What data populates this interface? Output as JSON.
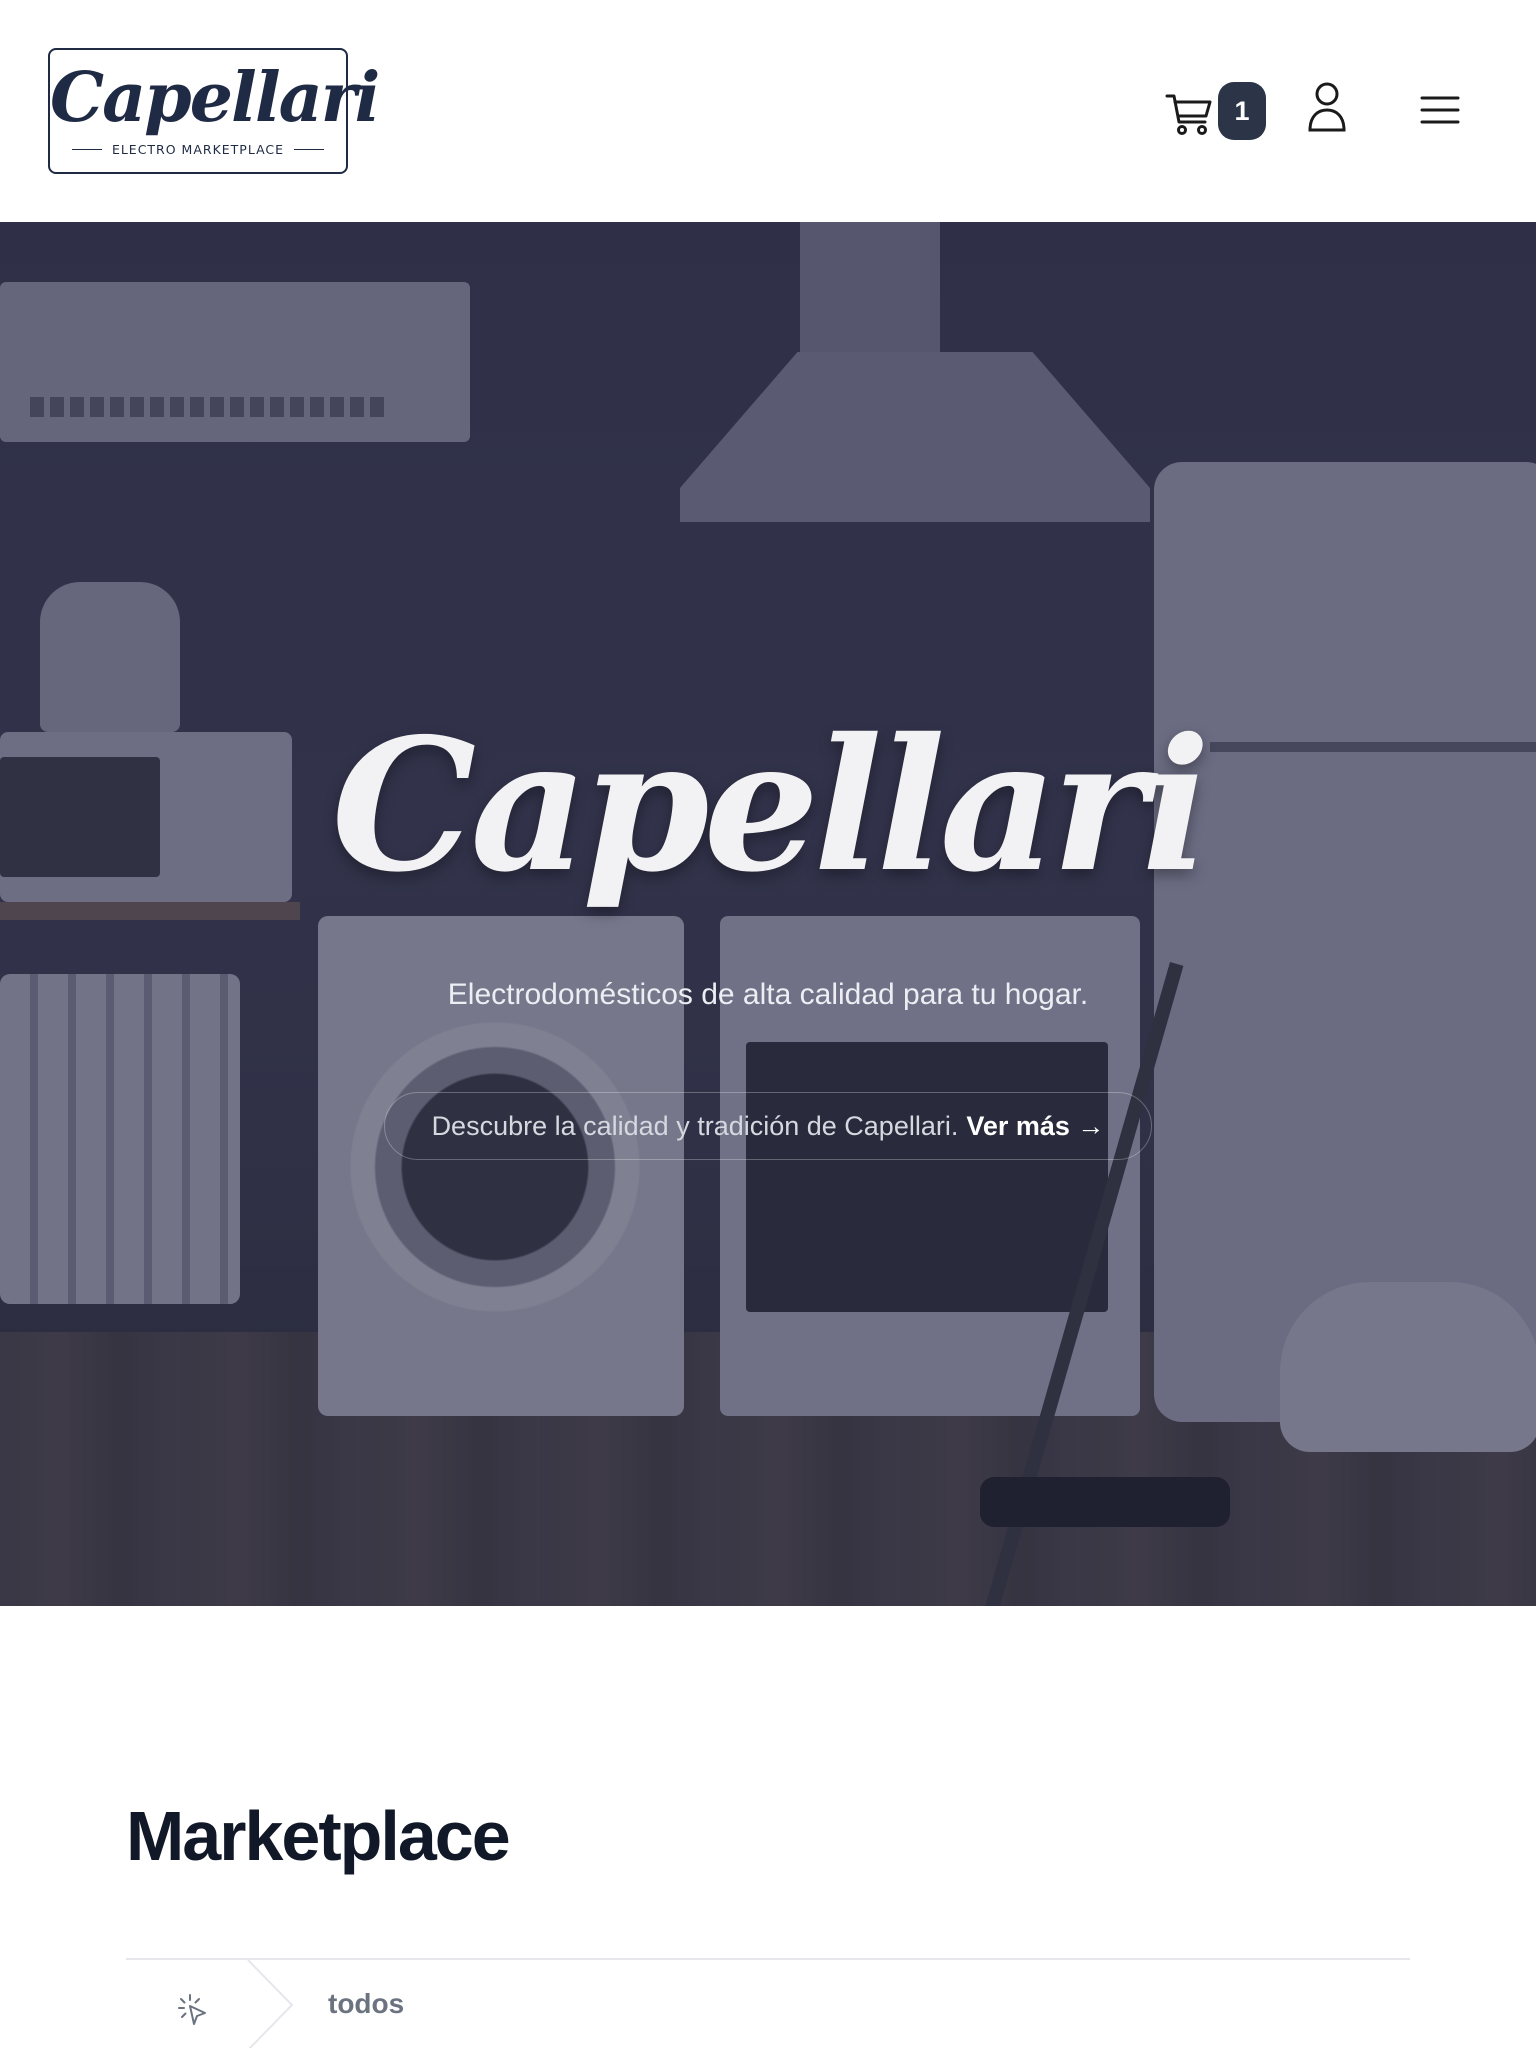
{
  "header": {
    "logo": {
      "name": "Capellari",
      "tagline": "ELECTRO MARKETPLACE"
    },
    "cart": {
      "icon": "cart-icon",
      "count": "1"
    },
    "user_icon": "user-icon",
    "menu_icon": "hamburger-menu-icon"
  },
  "hero": {
    "title": "Capellari",
    "subtitle": "Electrodomésticos de alta calidad para tu hogar.",
    "pill_text": "Descubre la calidad y tradición de Capellari.",
    "pill_link": "Ver más →"
  },
  "marketplace": {
    "title": "Marketplace",
    "breadcrumb": {
      "home_icon": "cursor-click-icon",
      "current": "todos"
    }
  },
  "colors": {
    "brand_navy": "#1f2a44",
    "badge_bg": "#2b3547",
    "muted_text": "#6b7280"
  }
}
